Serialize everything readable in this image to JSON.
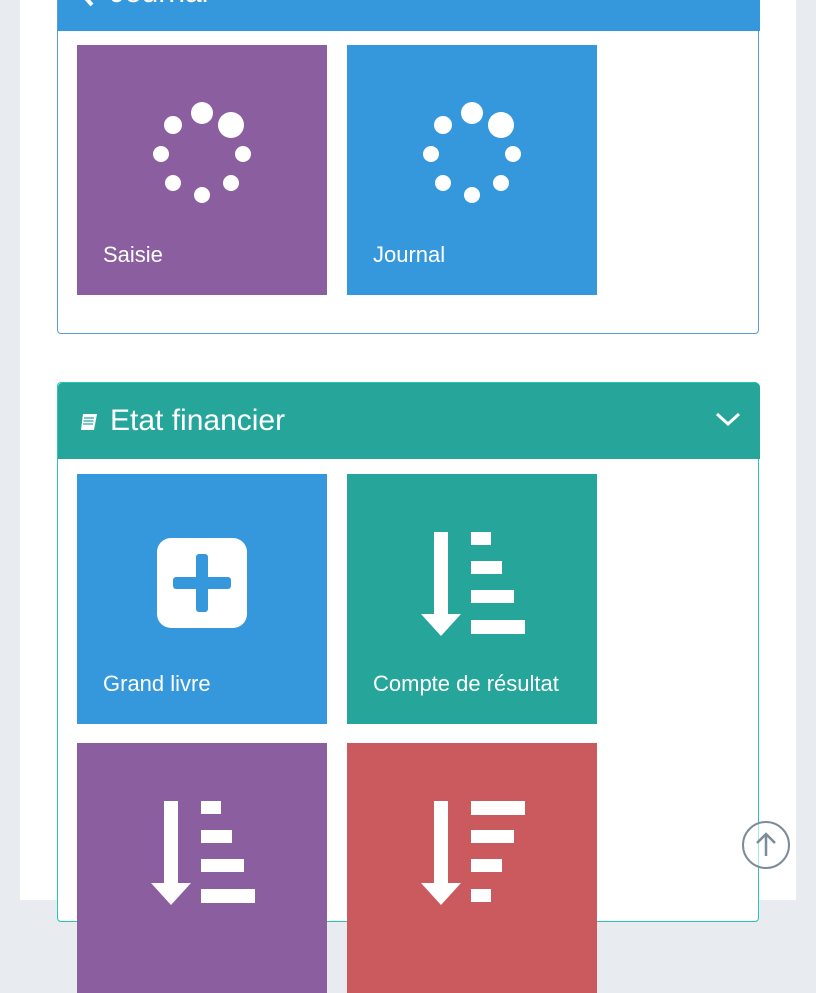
{
  "colors": {
    "purple": "#8b5ea0",
    "blue": "#3598dc",
    "teal": "#26a69a",
    "red": "#cb5a5e",
    "page_bg": "#e8ebf0"
  },
  "journal_panel": {
    "title": "Journal",
    "tiles": [
      {
        "label": "Saisie",
        "icon": "spinner-icon",
        "color": "purple"
      },
      {
        "label": "Journal",
        "icon": "spinner-icon",
        "color": "blue"
      }
    ]
  },
  "etat_panel": {
    "title": "Etat financier",
    "icon": "book-icon",
    "toggle_icon": "chevron-down-icon",
    "tiles": [
      {
        "label": "Grand livre",
        "icon": "plus-square-icon",
        "color": "blue"
      },
      {
        "label": "Compte de résultat",
        "icon": "sort-amount-asc-icon",
        "color": "teal"
      },
      {
        "label": "",
        "icon": "sort-amount-asc-icon",
        "color": "purple"
      },
      {
        "label": "",
        "icon": "sort-amount-desc-icon",
        "color": "red"
      }
    ]
  },
  "scroll_top": {
    "icon": "arrow-up-circle-icon"
  }
}
